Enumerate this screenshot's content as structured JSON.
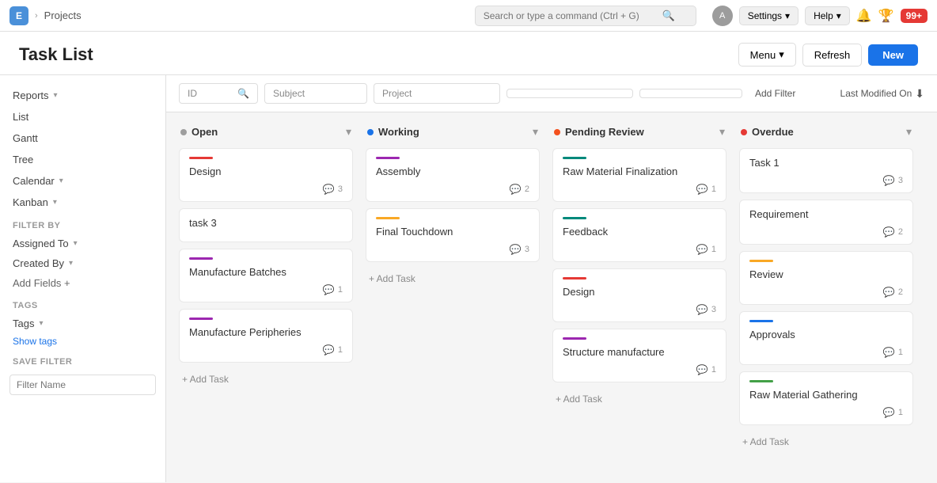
{
  "topNav": {
    "appIcon": "E",
    "chevron": "›",
    "projects": "Projects",
    "search": {
      "placeholder": "Search or type a command (Ctrl + G)"
    },
    "settings": "Settings",
    "help": "Help",
    "badge": "99+"
  },
  "pageHeader": {
    "title": "Task List",
    "menu": "Menu",
    "refresh": "Refresh",
    "new": "New"
  },
  "sidebar": {
    "reports": "Reports",
    "list": "List",
    "gantt": "Gantt",
    "tree": "Tree",
    "calendar": "Calendar",
    "kanban": "Kanban",
    "filterBy": "FILTER BY",
    "assignedTo": "Assigned To",
    "createdBy": "Created By",
    "addFields": "Add Fields +",
    "tags": "TAGS",
    "tagsBtn": "Tags",
    "showTags": "Show tags",
    "saveFilter": "SAVE FILTER",
    "filterNamePlaceholder": "Filter Name"
  },
  "filterBar": {
    "idPlaceholder": "ID",
    "subjectPlaceholder": "Subject",
    "projectPlaceholder": "Project",
    "addFilter": "Add Filter",
    "lastModified": "Last Modified On"
  },
  "columns": [
    {
      "id": "open",
      "title": "Open",
      "dotClass": "dot-open",
      "cards": [
        {
          "priority": "priority-red",
          "title": "Design",
          "comments": 3
        },
        {
          "priority": "",
          "title": "task 3",
          "comments": 0
        },
        {
          "priority": "priority-purple",
          "title": "Manufacture Batches",
          "comments": 1
        },
        {
          "priority": "priority-purple",
          "title": "Manufacture Peripheries",
          "comments": 1
        }
      ]
    },
    {
      "id": "working",
      "title": "Working",
      "dotClass": "dot-working",
      "cards": [
        {
          "priority": "priority-purple",
          "title": "Assembly",
          "comments": 2
        },
        {
          "priority": "priority-yellow",
          "title": "Final Touchdown",
          "comments": 3
        }
      ]
    },
    {
      "id": "pending-review",
      "title": "Pending Review",
      "dotClass": "dot-pending",
      "cards": [
        {
          "priority": "priority-teal",
          "title": "Raw Material Finalization",
          "comments": 1
        },
        {
          "priority": "priority-teal",
          "title": "Feedback",
          "comments": 1
        },
        {
          "priority": "priority-red",
          "title": "Design",
          "comments": 3
        },
        {
          "priority": "priority-purple",
          "title": "Structure manufacture",
          "comments": 1
        }
      ]
    },
    {
      "id": "overdue",
      "title": "Overdue",
      "dotClass": "dot-overdue",
      "cards": [
        {
          "priority": "",
          "title": "Task 1",
          "comments": 3
        },
        {
          "priority": "",
          "title": "Requirement",
          "comments": 2
        },
        {
          "priority": "priority-yellow",
          "title": "Review",
          "comments": 2
        },
        {
          "priority": "priority-blue",
          "title": "Approvals",
          "comments": 1
        },
        {
          "priority": "priority-green",
          "title": "Raw Material Gathering",
          "comments": 1
        }
      ]
    }
  ],
  "addTask": "+ Add Task"
}
